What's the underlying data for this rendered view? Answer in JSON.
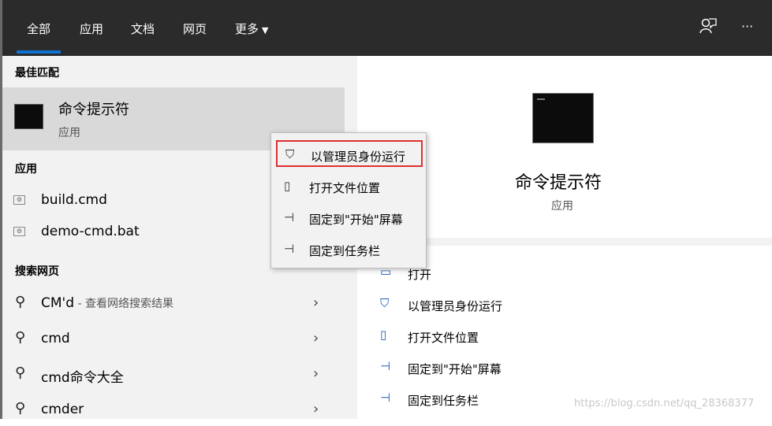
{
  "tabs": [
    {
      "label": "全部"
    },
    {
      "label": "应用"
    },
    {
      "label": "文档"
    },
    {
      "label": "网页"
    },
    {
      "label": "更多"
    }
  ],
  "icons": {
    "feedback": "feedback-person-icon",
    "more": "ellipsis-icon",
    "more_glyph": "···",
    "caret": "▼"
  },
  "sections": {
    "best_match": "最佳匹配",
    "apps": "应用",
    "web": "搜索网页"
  },
  "best_match": {
    "title": "命令提示符",
    "subtitle": "应用"
  },
  "apps": [
    {
      "prefix": "",
      "bold": "build.",
      "rest_bold": "cmd",
      "label_html": "build.cmd"
    },
    {
      "label_html": "demo-cmd.bat"
    }
  ],
  "web": [
    {
      "query": "CM'd",
      "suffix": " - 查看网络搜索结果"
    },
    {
      "query": "cmd",
      "suffix": ""
    },
    {
      "query": "cmd命令大全",
      "suffix": ""
    },
    {
      "query": "cmder",
      "suffix": ""
    }
  ],
  "preview": {
    "title": "命令提示符",
    "subtitle": "应用"
  },
  "actions": [
    {
      "label": "打开"
    },
    {
      "label": "以管理员身份运行"
    },
    {
      "label": "打开文件位置"
    },
    {
      "label": "固定到\"开始\"屏幕"
    },
    {
      "label": "固定到任务栏"
    }
  ],
  "context_menu": [
    {
      "label": "以管理员身份运行",
      "highlighted": true
    },
    {
      "label": "打开文件位置"
    },
    {
      "label": "固定到\"开始\"屏幕"
    },
    {
      "label": "固定到任务栏"
    }
  ],
  "watermark": "https://blog.csdn.net/qq_28368377",
  "colors": {
    "accent": "#0f73d1",
    "highlight_border": "#e03030",
    "topbar": "#2b2b2b"
  }
}
